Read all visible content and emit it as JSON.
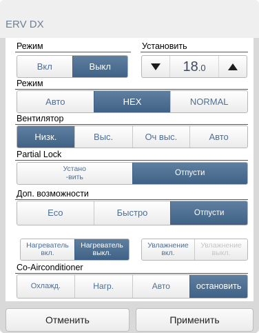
{
  "window": {
    "title": "ERV DX"
  },
  "mode": {
    "label": "Режим",
    "options": [
      {
        "label": "Вкл",
        "active": false
      },
      {
        "label": "Выкл",
        "active": true
      }
    ]
  },
  "setpoint": {
    "label": "Установить",
    "value_int": "18",
    "value_dec": ".0",
    "down_icon": "triangle-down-icon",
    "up_icon": "triangle-up-icon"
  },
  "vent_mode": {
    "label": "Режим",
    "options": [
      {
        "label": "Авто",
        "active": false
      },
      {
        "label": "HEX",
        "active": true
      },
      {
        "label": "NORMAL",
        "active": false
      }
    ]
  },
  "fan": {
    "label": "Вентилятор",
    "options": [
      {
        "label": "Низк.",
        "active": true
      },
      {
        "label": "Выс.",
        "active": false
      },
      {
        "label": "Оч выс.",
        "active": false
      },
      {
        "label": "Авто",
        "active": false
      }
    ]
  },
  "partial_lock": {
    "label": "Partial Lock",
    "options": [
      {
        "line1": "Устано",
        "line2": "-вить",
        "active": false
      },
      {
        "label": "Отпусти",
        "active": true
      }
    ]
  },
  "extra": {
    "label": "Доп. возможности",
    "options": [
      {
        "label": "Eco",
        "active": false
      },
      {
        "label": "Быстро",
        "active": false
      },
      {
        "label": "Отпусти",
        "active": true
      }
    ]
  },
  "heater": {
    "options": [
      {
        "line1": "Нагреватель",
        "line2": "вкл.",
        "active": false
      },
      {
        "line1": "Нагреватель",
        "line2": "выкл.",
        "active": true
      }
    ]
  },
  "humidifier": {
    "options": [
      {
        "line1": "Увлажнение",
        "line2": "вкл.",
        "active": false
      },
      {
        "line1": "Увлажнение",
        "line2": "выкл.",
        "active": false,
        "disabled": true
      }
    ]
  },
  "co_ac": {
    "label": "Co-Airconditioner",
    "options": [
      {
        "label": "Охлажд.",
        "active": false
      },
      {
        "label": "Нагр.",
        "active": false
      },
      {
        "label": "Авто",
        "active": false
      },
      {
        "label": "остановить",
        "active": true
      }
    ]
  },
  "footer": {
    "cancel_label": "Отменить",
    "apply_label": "Применить"
  },
  "colors": {
    "accent": "#4f7196",
    "active_text": "#ffffff",
    "inactive_text": "#4d6f96",
    "disabled_text": "#c4c4c4",
    "title": "#6f7f92"
  }
}
